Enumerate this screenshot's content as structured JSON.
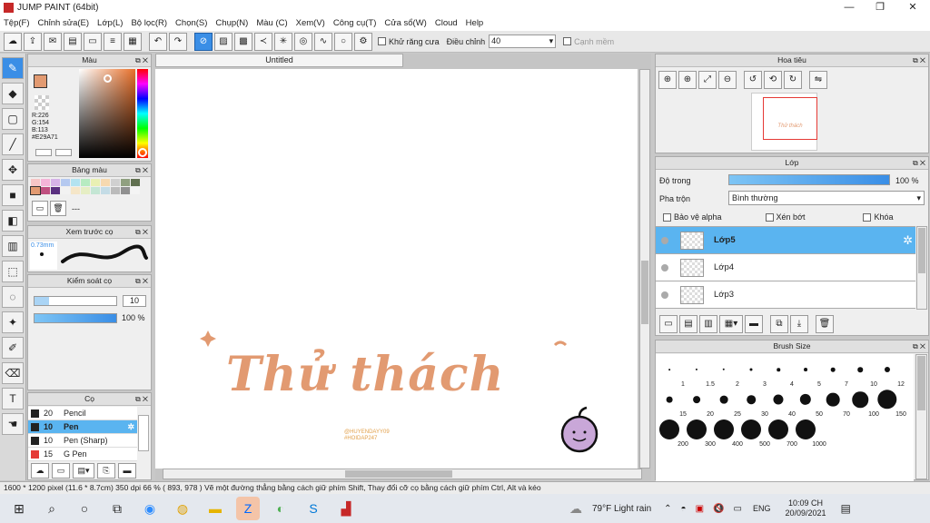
{
  "window": {
    "title": "JUMP PAINT (64bit)",
    "controls": [
      "—",
      "❐",
      "✕"
    ]
  },
  "menu": [
    "Tệp(F)",
    "Chỉnh sửa(E)",
    "Lớp(L)",
    "Bộ lọc(R)",
    "Chọn(S)",
    "Chụp(N)",
    "Màu (C)",
    "Xem(V)",
    "Công cụ(T)",
    "Cửa sổ(W)",
    "Cloud",
    "Help"
  ],
  "toolbar": {
    "antialias_label": "Khử răng cưa",
    "correction_label": "Điều chỉnh",
    "correction_value": "40",
    "edge_label": "Cạnh mềm"
  },
  "color_panel": {
    "title": "Màu",
    "r": "R:226",
    "g": "G:154",
    "b": "B:113",
    "hex": "#E29A71",
    "main_color": "#E29A71"
  },
  "swatch_panel": {
    "title": "Bảng màu",
    "dash": "---"
  },
  "brush_preview": {
    "title": "Xem trước cọ",
    "size": "0.73mm"
  },
  "brush_control": {
    "title": "Kiểm soát cọ",
    "size": "10",
    "opacity": "100 %"
  },
  "brush_list": {
    "title": "Cọ",
    "items": [
      {
        "size": "20",
        "name": "Pencil",
        "color": "#222"
      },
      {
        "size": "10",
        "name": "Pen",
        "color": "#222",
        "selected": true
      },
      {
        "size": "10",
        "name": "Pen (Sharp)",
        "color": "#222"
      },
      {
        "size": "15",
        "name": "G Pen",
        "color": "#e53935"
      }
    ]
  },
  "document": {
    "tab": "Untitled",
    "artwork_title": "Thử thách",
    "credit1": "@HUYENDAYY09",
    "credit2": "#HOIDAP247"
  },
  "navigator": {
    "title": "Hoa tiêu",
    "thumb_text": "Thử thách"
  },
  "layers": {
    "title": "Lớp",
    "opacity_label": "Độ trong",
    "opacity_value": "100 %",
    "opacity": 1.0,
    "blend_label": "Pha trộn",
    "blend_value": "Bình thường",
    "protect_alpha": "Bảo vệ alpha",
    "clipping": "Xén bớt",
    "lock": "Khóa",
    "items": [
      {
        "name": "Lớp5",
        "selected": true
      },
      {
        "name": "Lớp4"
      },
      {
        "name": "Lớp3"
      }
    ]
  },
  "brush_size": {
    "title": "Brush Size",
    "sizes": [
      "1",
      "1.5",
      "2",
      "3",
      "4",
      "5",
      "7",
      "10",
      "12",
      "15",
      "20",
      "25",
      "30",
      "40",
      "50",
      "70",
      "100",
      "150",
      "200",
      "300",
      "400",
      "500",
      "700",
      "1000"
    ]
  },
  "status": {
    "text": "1600 * 1200 pixel   (11.6 * 8.7cm)   350 dpi   66 %   ( 893, 978 )   Vẽ một đường thẳng bằng cách giữ phím Shift, Thay đổi cỡ cọ bằng cách giữ phím Ctrl, Alt và kéo"
  },
  "taskbar": {
    "weather": "79°F  Light rain",
    "lang": "ENG",
    "time": "10:09 CH",
    "date": "20/09/2021"
  }
}
